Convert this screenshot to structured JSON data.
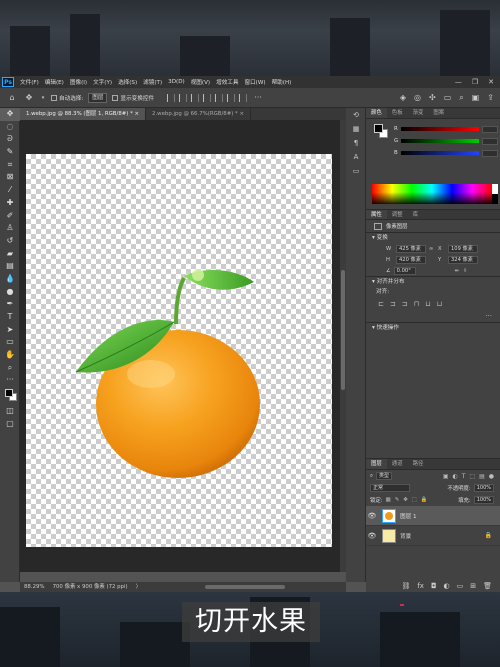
{
  "menubar": {
    "logo": "Ps",
    "items": [
      "文件(F)",
      "编辑(E)",
      "图像(I)",
      "文字(Y)",
      "选择(S)",
      "滤镜(T)",
      "3D(D)",
      "视图(V)",
      "增效工具",
      "窗口(W)",
      "帮助(H)"
    ],
    "window_controls": [
      "—",
      "❐",
      "✕"
    ]
  },
  "optionsbar": {
    "auto_select_label": "自动选择:",
    "auto_select_value": "图层",
    "show_transform_label": "显示变换控件",
    "more": "···"
  },
  "tabs": [
    {
      "label": "1.webp.jpg @ 88.3% (图层 1, RGB/8#) *",
      "close": "×"
    },
    {
      "label": "2.webp.jpg @ 66.7%(RGB/8#) *",
      "close": "×"
    }
  ],
  "statusbar": {
    "zoom": "88.29%",
    "doc_size": "700 像素 x 900 像素 (72 ppi)",
    "arrow": "〉"
  },
  "subtitle": "切开水果",
  "color_panel": {
    "tabs": [
      "颜色",
      "色板",
      "渐变",
      "图案"
    ],
    "sliders": [
      {
        "label": "R",
        "value": "",
        "color": "#ff3030"
      },
      {
        "label": "G",
        "value": "",
        "color": "#30c030"
      },
      {
        "label": "B",
        "value": "",
        "color": "#3050ff"
      }
    ]
  },
  "properties_panel": {
    "tabs": [
      "属性",
      "调整",
      "库"
    ],
    "layer_label": "像素图层",
    "transform_title": "变换",
    "w_label": "W",
    "w_value": "425 像素",
    "x_label": "X",
    "x_value": "109 像素",
    "h_label": "H",
    "h_value": "420 像素",
    "y_label": "Y",
    "y_value": "324 像素",
    "angle_value": "0.00°",
    "align_title": "对齐并分布",
    "align_sub": "对齐:",
    "quick_actions_title": "快速操作"
  },
  "layers_panel": {
    "tabs": [
      "图层",
      "通道",
      "路径"
    ],
    "kind_label": "类型",
    "blend_mode": "正常",
    "opacity_label": "不透明度:",
    "opacity_value": "100%",
    "lock_label": "锁定:",
    "fill_label": "填充:",
    "fill_value": "100%",
    "layers": [
      {
        "name": "图层 1",
        "selected": true
      },
      {
        "name": "背景",
        "selected": false,
        "locked": true
      }
    ]
  },
  "colors": {
    "ps_gray": "#535353",
    "orange": "#f29a1a",
    "leaf_green": "#3fa02a",
    "ps_blue": "#31a8ff"
  }
}
